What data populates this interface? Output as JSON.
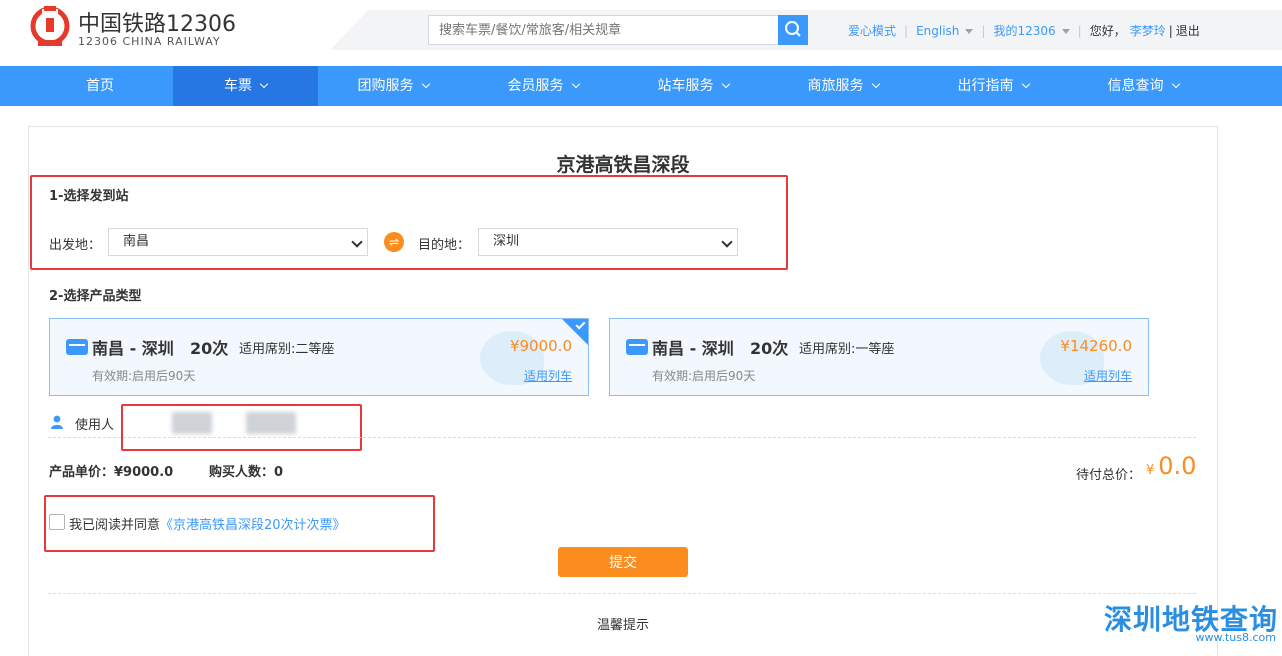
{
  "header": {
    "logo_cn": "中国铁路12306",
    "logo_en": "12306 CHINA RAILWAY",
    "search_placeholder": "搜索车票/餐饮/常旅客/相关规章",
    "links": {
      "care_mode": "爱心模式",
      "english": "English",
      "my12306": "我的12306",
      "greeting": "您好，",
      "user": "李梦玲",
      "divider": "|",
      "logout": "退出"
    }
  },
  "nav": [
    {
      "label": "首页"
    },
    {
      "label": "车票"
    },
    {
      "label": "团购服务"
    },
    {
      "label": "会员服务"
    },
    {
      "label": "站车服务"
    },
    {
      "label": "商旅服务"
    },
    {
      "label": "出行指南"
    },
    {
      "label": "信息查询"
    }
  ],
  "page": {
    "title": "京港高铁昌深段",
    "section1": "1-选择发到站",
    "from_label": "出发地：",
    "from_value": "南昌",
    "to_label": "目的地：",
    "to_value": "深圳",
    "section2": "2-选择产品类型",
    "user_label": "使用人",
    "unit_price": "产品单价：¥9000.0",
    "buyers": "购买人数：0",
    "total_label": "待付总价：",
    "total_currency": "¥",
    "total_value": "0.0",
    "agree_prefix": "我已阅读并同意",
    "agree_link": "《京港高铁昌深段20次计次票》",
    "submit": "提交",
    "tip": "温馨提示"
  },
  "products": [
    {
      "route": "南昌 - 深圳",
      "times": "20次",
      "seat": "适用席别:二等座",
      "valid": "有效期:启用后90天",
      "price": "¥9000.0",
      "link": "适用列车",
      "selected": true
    },
    {
      "route": "南昌 - 深圳",
      "times": "20次",
      "seat": "适用席别:一等座",
      "valid": "有效期:启用后90天",
      "price": "¥14260.0",
      "link": "适用列车",
      "selected": false
    }
  ],
  "watermark": {
    "cn": "深圳地铁查询",
    "en": "www.tus8.com"
  },
  "colors": {
    "primary": "#3b99fc",
    "nav_active": "#2676e3",
    "accent": "#fb8c1e",
    "highlight_box": "#e63a3a"
  },
  "icons": [
    "railway-logo-icon",
    "search-icon",
    "caret-down-icon",
    "chevron-down-icon",
    "swap-icon",
    "card-icon",
    "user-icon",
    "checkmark-icon"
  ]
}
